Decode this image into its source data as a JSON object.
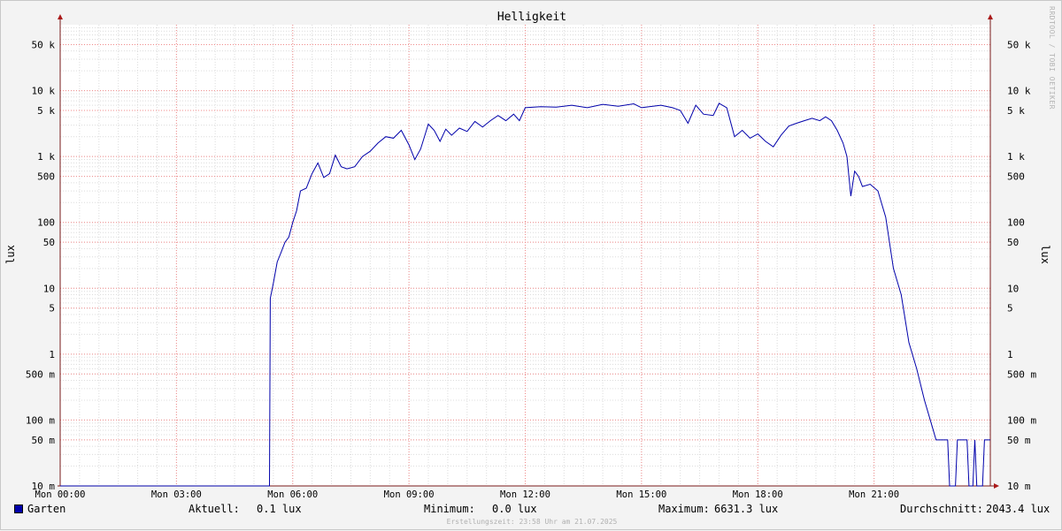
{
  "chart_data": {
    "type": "line",
    "title": "Helligkeit",
    "ylabel": "lux",
    "yscale": "log",
    "ylim": [
      0.01,
      100000
    ],
    "xlim": [
      0,
      24
    ],
    "grid": true,
    "x_ticks": [
      {
        "x": 0,
        "label": "Mon 00:00"
      },
      {
        "x": 3,
        "label": "Mon 03:00"
      },
      {
        "x": 6,
        "label": "Mon 06:00"
      },
      {
        "x": 9,
        "label": "Mon 09:00"
      },
      {
        "x": 12,
        "label": "Mon 12:00"
      },
      {
        "x": 15,
        "label": "Mon 15:00"
      },
      {
        "x": 18,
        "label": "Mon 18:00"
      },
      {
        "x": 21,
        "label": "Mon 21:00"
      }
    ],
    "y_ticks": [
      {
        "y": 50000,
        "label": "50 k"
      },
      {
        "y": 10000,
        "label": "10 k"
      },
      {
        "y": 5000,
        "label": "5 k"
      },
      {
        "y": 1000,
        "label": "1 k"
      },
      {
        "y": 500,
        "label": "500"
      },
      {
        "y": 100,
        "label": "100"
      },
      {
        "y": 50,
        "label": "50"
      },
      {
        "y": 10,
        "label": "10"
      },
      {
        "y": 5,
        "label": "5"
      },
      {
        "y": 1,
        "label": "1"
      },
      {
        "y": 0.5,
        "label": "500 m"
      },
      {
        "y": 0.1,
        "label": "100 m"
      },
      {
        "y": 0.05,
        "label": "50 m"
      },
      {
        "y": 0.01,
        "label": "10 m"
      }
    ],
    "series": [
      {
        "name": "Garten",
        "color": "#0000aa",
        "points": [
          [
            0,
            0.01
          ],
          [
            5.4,
            0.01
          ],
          [
            5.42,
            7
          ],
          [
            5.5,
            12
          ],
          [
            5.6,
            25
          ],
          [
            5.7,
            35
          ],
          [
            5.8,
            50
          ],
          [
            5.9,
            60
          ],
          [
            6.0,
            100
          ],
          [
            6.1,
            150
          ],
          [
            6.2,
            300
          ],
          [
            6.35,
            330
          ],
          [
            6.5,
            550
          ],
          [
            6.65,
            800
          ],
          [
            6.8,
            480
          ],
          [
            6.95,
            550
          ],
          [
            7.1,
            1050
          ],
          [
            7.25,
            700
          ],
          [
            7.4,
            650
          ],
          [
            7.6,
            700
          ],
          [
            7.8,
            1000
          ],
          [
            8.0,
            1200
          ],
          [
            8.2,
            1600
          ],
          [
            8.4,
            2000
          ],
          [
            8.6,
            1900
          ],
          [
            8.8,
            2500
          ],
          [
            9.0,
            1500
          ],
          [
            9.15,
            900
          ],
          [
            9.3,
            1300
          ],
          [
            9.5,
            3100
          ],
          [
            9.65,
            2500
          ],
          [
            9.8,
            1700
          ],
          [
            9.95,
            2600
          ],
          [
            10.1,
            2100
          ],
          [
            10.3,
            2700
          ],
          [
            10.5,
            2400
          ],
          [
            10.7,
            3400
          ],
          [
            10.9,
            2800
          ],
          [
            11.1,
            3500
          ],
          [
            11.3,
            4200
          ],
          [
            11.5,
            3500
          ],
          [
            11.7,
            4400
          ],
          [
            11.85,
            3500
          ],
          [
            12.0,
            5500
          ],
          [
            12.4,
            5700
          ],
          [
            12.8,
            5600
          ],
          [
            13.2,
            6000
          ],
          [
            13.6,
            5500
          ],
          [
            14.0,
            6200
          ],
          [
            14.4,
            5800
          ],
          [
            14.8,
            6300
          ],
          [
            15.0,
            5500
          ],
          [
            15.2,
            5700
          ],
          [
            15.5,
            6000
          ],
          [
            15.8,
            5500
          ],
          [
            16.0,
            5000
          ],
          [
            16.2,
            3200
          ],
          [
            16.4,
            6000
          ],
          [
            16.6,
            4400
          ],
          [
            16.85,
            4200
          ],
          [
            17.0,
            6400
          ],
          [
            17.2,
            5500
          ],
          [
            17.4,
            2000
          ],
          [
            17.6,
            2500
          ],
          [
            17.8,
            1900
          ],
          [
            18.0,
            2200
          ],
          [
            18.2,
            1700
          ],
          [
            18.4,
            1400
          ],
          [
            18.6,
            2100
          ],
          [
            18.8,
            2900
          ],
          [
            19.0,
            3200
          ],
          [
            19.2,
            3500
          ],
          [
            19.4,
            3800
          ],
          [
            19.6,
            3500
          ],
          [
            19.75,
            4000
          ],
          [
            19.9,
            3500
          ],
          [
            20.05,
            2500
          ],
          [
            20.2,
            1600
          ],
          [
            20.3,
            1000
          ],
          [
            20.4,
            250
          ],
          [
            20.5,
            600
          ],
          [
            20.6,
            500
          ],
          [
            20.7,
            350
          ],
          [
            20.9,
            380
          ],
          [
            21.1,
            300
          ],
          [
            21.3,
            120
          ],
          [
            21.5,
            20
          ],
          [
            21.7,
            8
          ],
          [
            21.9,
            1.5
          ],
          [
            22.1,
            0.6
          ],
          [
            22.3,
            0.2
          ],
          [
            22.5,
            0.08
          ],
          [
            22.6,
            0.05
          ],
          [
            22.9,
            0.05
          ],
          [
            22.95,
            0.01
          ],
          [
            23.1,
            0.01
          ],
          [
            23.15,
            0.05
          ],
          [
            23.4,
            0.05
          ],
          [
            23.45,
            0.01
          ],
          [
            23.55,
            0.01
          ],
          [
            23.6,
            0.05
          ],
          [
            23.65,
            0.01
          ],
          [
            23.8,
            0.01
          ],
          [
            23.85,
            0.05
          ],
          [
            24.0,
            0.05
          ]
        ]
      }
    ]
  },
  "watermark": "RRDTOOL / TOBI OETIKER",
  "legend": {
    "series_name": "Garten",
    "current_label": "Aktuell:",
    "current_value": "0.1 lux",
    "minimum_label": "Minimum:",
    "minimum_value": "0.0 lux",
    "maximum_label": "Maximum:",
    "maximum_value": "6631.3 lux",
    "average_label": "Durchschnitt:",
    "average_value": "2043.4 lux"
  },
  "footer": "Erstellungszeit: 23:58 Uhr am 21.07.2025"
}
